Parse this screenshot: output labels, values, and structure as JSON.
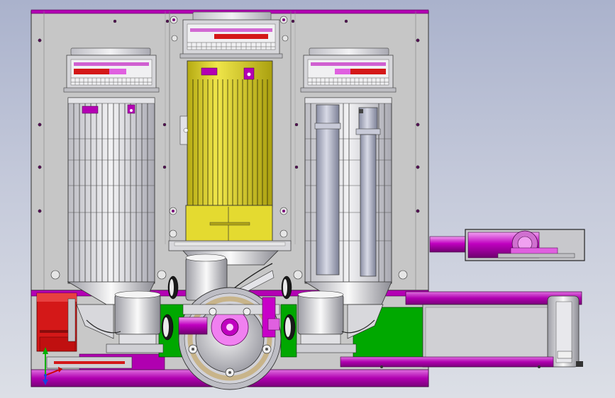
{
  "colors": {
    "plate": "#c5c5c5",
    "plate_edge": "#4a4a4a",
    "accent_magenta": "#b400b4",
    "magenta_light": "#e060e0",
    "motor_yellow": "#dcd21e",
    "motor_yellow_dark": "#a89c10",
    "base_green": "#00a800",
    "gearbox_red": "#d41818",
    "steel_light": "#ededed",
    "steel_mid": "#b4b4bc",
    "steel_dark": "#6c6c74",
    "cylinder_blue": "#a6aabf",
    "line": "#333333",
    "bearing_tan": "#c8b48a",
    "axis_y": "#00b000",
    "axis_x": "#d00000",
    "axis_z": "#1840e0"
  },
  "icons": {
    "triad": "coordinate-triad-icon"
  }
}
